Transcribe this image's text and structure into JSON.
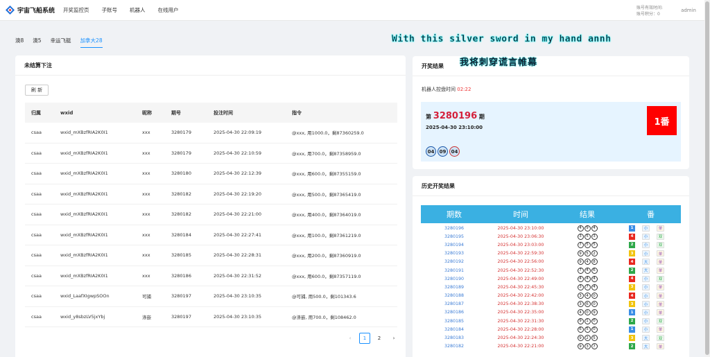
{
  "app": {
    "title": "宇宙飞船系统"
  },
  "nav": [
    "开奖监控页",
    "子账号",
    "机器人",
    "在线用户"
  ],
  "account": {
    "expiry_label": "账号有效时间:",
    "points_label": "账号积分：0",
    "user": "admin"
  },
  "tabs": [
    "澳8",
    "澳5",
    "幸运飞艇",
    "加拿大28"
  ],
  "banner": {
    "line1": "With this silver sword in my hand annh",
    "line2": "我将刺穿谎言帷幕"
  },
  "unsettled": {
    "title": "未结算下注",
    "refresh_label": "刷 新",
    "columns": [
      "归属",
      "wxid",
      "昵称",
      "期号",
      "投注时间",
      "指令"
    ],
    "rows": [
      [
        "csaa",
        "wxid_mXBzfRIA2K0I1",
        "xxx",
        "3280179",
        "2025-04-30 22:09:19",
        "@xxx, 用1000.0，剩87360259.0"
      ],
      [
        "csaa",
        "wxid_mXBzfRIA2K0I1",
        "xxx",
        "3280179",
        "2025-04-30 22:10:59",
        "@xxx, 用700.0，剩87358959.0"
      ],
      [
        "csaa",
        "wxid_mXBzfRIA2K0I1",
        "xxx",
        "3280180",
        "2025-04-30 22:12:39",
        "@xxx, 用600.0，剩87355159.0"
      ],
      [
        "csaa",
        "wxid_mXBzfRIA2K0I1",
        "xxx",
        "3280182",
        "2025-04-30 22:19:20",
        "@xxx, 用500.0，剩87365419.0"
      ],
      [
        "csaa",
        "wxid_mXBzfRIA2K0I1",
        "xxx",
        "3280182",
        "2025-04-30 22:21:00",
        "@xxx, 用400.0，剩87364019.0"
      ],
      [
        "csaa",
        "wxid_mXBzfRIA2K0I1",
        "xxx",
        "3280184",
        "2025-04-30 22:27:41",
        "@xxx, 用100.0，剩87361219.0"
      ],
      [
        "csaa",
        "wxid_mXBzfRIA2K0I1",
        "xxx",
        "3280185",
        "2025-04-30 22:28:31",
        "@xxx, 用200.0，剩87360919.0"
      ],
      [
        "csaa",
        "wxid_mXBzfRIA2K0I1",
        "xxx",
        "3280186",
        "2025-04-30 22:31:52",
        "@xxx, 用600.0，剩87357119.0"
      ],
      [
        "csaa",
        "wxid_LaafXIgwpSOOn",
        "可捕",
        "3280197",
        "2025-04-30 23:10:35",
        "@可捕, 用500.0，剩101343.6"
      ],
      [
        "csaa",
        "wxid_y8sbzLV5jxYbj",
        "涤嵌",
        "3280197",
        "2025-04-30 23:10:35",
        "@涤嵌, 用700.0，剩108462.0"
      ]
    ],
    "pages": [
      "1",
      "2"
    ]
  },
  "result": {
    "title": "开奖结果",
    "timer_label": "机器人控盘时间",
    "timer_value": "02:22",
    "issue_prefix": "第",
    "issue_number": "3280196",
    "issue_suffix": "期",
    "draw_time": "2025-04-30 23:10:00",
    "fan": "1番",
    "balls": [
      "04",
      "09",
      "04"
    ]
  },
  "history": {
    "title": "历史开奖结果",
    "columns": [
      "期数",
      "时间",
      "结果",
      "番"
    ],
    "rows": [
      {
        "issue": "3280196",
        "time": "2025-04-30 23:10:00",
        "balls": [
          "4",
          "9",
          "4"
        ],
        "fan": "1",
        "size": "小",
        "parity": "单"
      },
      {
        "issue": "3280195",
        "time": "2025-04-30 23:06:30",
        "balls": [
          "3",
          "5",
          "3"
        ],
        "fan": "4",
        "size": "小",
        "parity": "双"
      },
      {
        "issue": "3280194",
        "time": "2025-04-30 23:03:00",
        "balls": [
          "7",
          "5",
          "5"
        ],
        "fan": "2",
        "size": "小",
        "parity": "双"
      },
      {
        "issue": "3280193",
        "time": "2025-04-30 22:59:30",
        "balls": [
          "9",
          "5",
          "2"
        ],
        "fan": "3",
        "size": "小",
        "parity": "单"
      },
      {
        "issue": "3280192",
        "time": "2025-04-30 22:56:00",
        "balls": [
          "9",
          "4",
          "8"
        ],
        "fan": "4",
        "size": "大",
        "parity": "单"
      },
      {
        "issue": "3280191",
        "time": "2025-04-30 22:52:30",
        "balls": [
          "7",
          "4",
          "6"
        ],
        "fan": "2",
        "size": "大",
        "parity": "单"
      },
      {
        "issue": "3280190",
        "time": "2025-04-30 22:49:00",
        "balls": [
          "4",
          "4",
          "4"
        ],
        "fan": "4",
        "size": "小",
        "parity": "双"
      },
      {
        "issue": "3280189",
        "time": "2025-04-30 22:45:30",
        "balls": [
          "3",
          "7",
          "4"
        ],
        "fan": "3",
        "size": "小",
        "parity": "单"
      },
      {
        "issue": "3280188",
        "time": "2025-04-30 22:42:00",
        "balls": [
          "3",
          "4",
          "0"
        ],
        "fan": "4",
        "size": "小",
        "parity": "单"
      },
      {
        "issue": "3280187",
        "time": "2025-04-30 22:38:30",
        "balls": [
          "3",
          "6",
          "0"
        ],
        "fan": "3",
        "size": "小",
        "parity": "单"
      },
      {
        "issue": "3280186",
        "time": "2025-04-30 22:35:00",
        "balls": [
          "4",
          "0",
          "9"
        ],
        "fan": "1",
        "size": "小",
        "parity": "单"
      },
      {
        "issue": "3280185",
        "time": "2025-04-30 22:31:30",
        "balls": [
          "9",
          "1",
          "0"
        ],
        "fan": "2",
        "size": "小",
        "parity": "双"
      },
      {
        "issue": "3280184",
        "time": "2025-04-30 22:28:00",
        "balls": [
          "6",
          "5",
          "0"
        ],
        "fan": "1",
        "size": "小",
        "parity": "单"
      },
      {
        "issue": "3280183",
        "time": "2025-04-30 22:24:30",
        "balls": [
          "9",
          "2",
          "5"
        ],
        "fan": "3",
        "size": "大",
        "parity": "双"
      },
      {
        "issue": "3280182",
        "time": "2025-04-30 22:21:00",
        "balls": [
          "9",
          "3",
          "7"
        ],
        "fan": "2",
        "size": "大",
        "parity": "单"
      }
    ]
  },
  "colors": {
    "accent": "#1890ff",
    "fan1": "#3a8ee6",
    "fan2": "#2ea84a",
    "fan3": "#f1c40f",
    "fan4": "#e8271f",
    "header": "#3ab0e2"
  },
  "icons": {
    "logo": "diamond-logo-icon",
    "prev": "chevron-left-icon",
    "next": "chevron-right-icon"
  }
}
